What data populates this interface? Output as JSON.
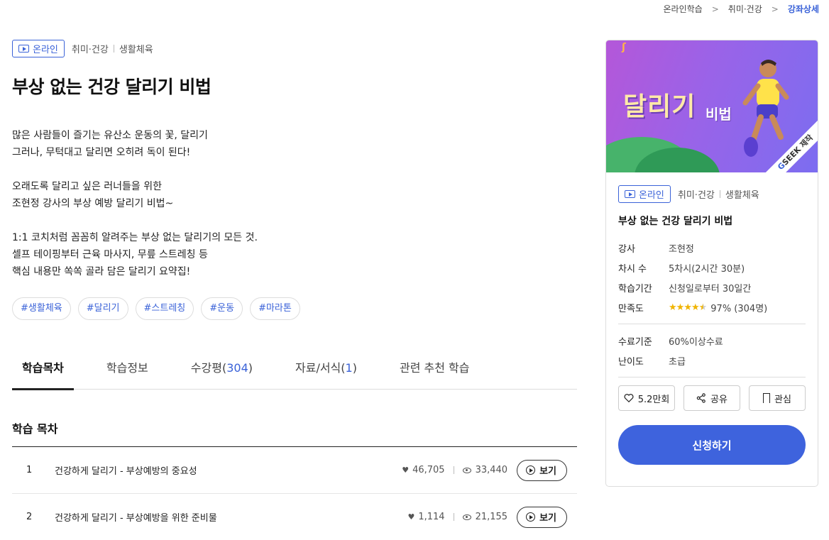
{
  "breadcrumb": {
    "items": [
      "온라인학습",
      "취미·건강"
    ],
    "current": "강좌상세"
  },
  "course": {
    "badge_label": "온라인",
    "category_1": "취미·건강",
    "category_2": "생활체육",
    "title": "부상 없는 건강 달리기 비법",
    "description": [
      [
        "많은 사람들이 즐기는 유산소 운동의 꽃, 달리기",
        "그러나, 무턱대고 달리면 오히려 독이 된다!"
      ],
      [
        "오래도록 달리고 싶은 러너들을 위한",
        "조현정 강사의 부상 예방 달리기 비법~"
      ],
      [
        "1:1 코치처럼 꼼꼼히 알려주는 부상 없는 달리기의 모든 것.",
        "셀프 테이핑부터 근육 마사지, 무릎 스트레칭 등",
        "핵심 내용만 쏙쏙 골라 담은 달리기 요약집!"
      ]
    ],
    "tags": [
      "#생활체육",
      "#달리기",
      "#스트레칭",
      "#운동",
      "#마라톤"
    ]
  },
  "tabs": [
    {
      "label": "학습목차",
      "count": "",
      "active": true
    },
    {
      "label": "학습정보",
      "count": "",
      "active": false
    },
    {
      "label": "수강평",
      "count": "304",
      "active": false
    },
    {
      "label": "자료/서식",
      "count": "1",
      "active": false
    },
    {
      "label": "관련 추천 학습",
      "count": "",
      "active": false
    }
  ],
  "toc": {
    "title": "학습 목차",
    "rows": [
      {
        "num": "1",
        "name": "건강하게 달리기 - 부상예방의 중요성",
        "likes": "46,705",
        "views": "33,440",
        "button": "보기"
      },
      {
        "num": "2",
        "name": "건강하게 달리기 - 부상예방을 위한 준비물",
        "likes": "1,114",
        "views": "21,155",
        "button": "보기"
      }
    ]
  },
  "card": {
    "thumb_title": "달리기",
    "thumb_sub": "비법",
    "thumb_ribbon_g": "G",
    "thumb_ribbon_rest": "SEEK 제작",
    "badge_label": "온라인",
    "category_1": "취미·건강",
    "category_2": "생활체육",
    "title": "부상 없는 건강 달리기 비법",
    "info": {
      "instructor_label": "강사",
      "instructor": "조현정",
      "sessions_label": "차시 수",
      "sessions": "5차시(2시간 30분)",
      "period_label": "학습기간",
      "period": "신청일로부터 30일간",
      "satisfaction_label": "만족도",
      "satisfaction": "97% (304명)",
      "rating": 4.5
    },
    "completion_label": "수료기준",
    "completion": "60%이상수료",
    "level_label": "난이도",
    "level": "초급",
    "actions": {
      "like": "5.2만회",
      "share": "공유",
      "bookmark": "관심"
    },
    "apply": "신청하기"
  },
  "colors": {
    "accent": "#3e63dd",
    "link": "#3a62d8",
    "star": "#f0b400"
  }
}
